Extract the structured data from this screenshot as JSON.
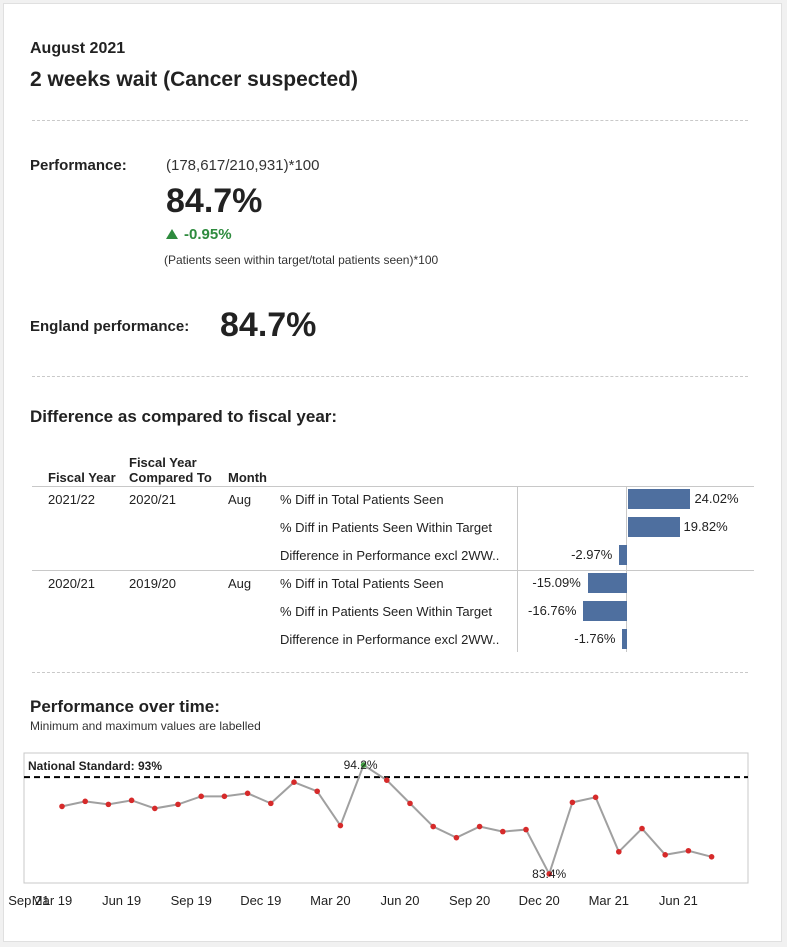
{
  "header": {
    "month": "August 2021",
    "title": "2 weeks wait (Cancer suspected)"
  },
  "performance": {
    "label": "Performance:",
    "formula": "(178,617/210,931)*100",
    "value": "84.7%",
    "change": "-0.95%",
    "description": "(Patients seen within target/total patients seen)*100"
  },
  "england": {
    "label": "England performance:",
    "value": "84.7%"
  },
  "comparison": {
    "title": "Difference as compared to fiscal year:",
    "headers": {
      "fiscal_year": "Fiscal Year",
      "compared_line1": "Fiscal Year",
      "compared_line2": "Compared To",
      "month": "Month"
    },
    "groups": [
      {
        "fiscal_year": "2021/22",
        "compared_to": "2020/21",
        "month": "Aug",
        "rows": [
          {
            "measure": "% Diff in Total Patients Seen",
            "value": 24.02,
            "label": "24.02%"
          },
          {
            "measure": "% Diff in Patients Seen Within Target",
            "value": 19.82,
            "label": "19.82%"
          },
          {
            "measure": "Difference in Performance excl 2WW..",
            "value": -2.97,
            "label": "-2.97%"
          }
        ]
      },
      {
        "fiscal_year": "2020/21",
        "compared_to": "2019/20",
        "month": "Aug",
        "rows": [
          {
            "measure": "% Diff in Total Patients Seen",
            "value": -15.09,
            "label": "-15.09%"
          },
          {
            "measure": "% Diff in Patients Seen Within Target",
            "value": -16.76,
            "label": "-16.76%"
          },
          {
            "measure": "Difference in Performance excl 2WW..",
            "value": -1.76,
            "label": "-1.76%"
          }
        ]
      }
    ],
    "bar_color": "#4e6f9f"
  },
  "time_chart": {
    "title": "Performance over time:",
    "subtitle": "Minimum and maximum values are labelled",
    "standard_label": "National Standard: 93%",
    "max_label": "94.2%",
    "min_label": "83.4%"
  },
  "chart_data": {
    "type": "line",
    "x": [
      "Mar 19",
      "Apr 19",
      "May 19",
      "Jun 19",
      "Jul 19",
      "Aug 19",
      "Sep 19",
      "Oct 19",
      "Nov 19",
      "Dec 19",
      "Jan 20",
      "Feb 20",
      "Mar 20",
      "Apr 20",
      "May 20",
      "Jun 20",
      "Jul 20",
      "Aug 20",
      "Sep 20",
      "Oct 20",
      "Nov 20",
      "Dec 20",
      "Jan 21",
      "Feb 21",
      "Mar 21",
      "Apr 21",
      "May 21",
      "Jun 21",
      "Jul 21",
      "Aug 21"
    ],
    "series": [
      {
        "values": [
          90.1,
          90.6,
          90.3,
          90.7,
          89.9,
          90.3,
          91.1,
          91.1,
          91.4,
          90.4,
          92.5,
          91.6,
          88.2,
          94.2,
          92.7,
          90.4,
          88.1,
          87.0,
          88.1,
          87.6,
          87.8,
          83.4,
          90.5,
          91.0,
          85.6,
          87.9,
          85.3,
          85.7,
          85.1
        ]
      }
    ],
    "x_ticks": [
      "Mar 19",
      "Jun 19",
      "Sep 19",
      "Dec 19",
      "Mar 20",
      "Jun 20",
      "Sep 20",
      "Dec 20",
      "Mar 21",
      "Jun 21",
      "Sep 21"
    ],
    "reference_line": {
      "label": "National Standard: 93%",
      "value": 93
    },
    "ylim": [
      82.8,
      95.0
    ],
    "colors": {
      "line": "#a0a0a0",
      "point": "#d62a2a",
      "max_point": "#3f9a3f",
      "reference": "#000000"
    }
  }
}
